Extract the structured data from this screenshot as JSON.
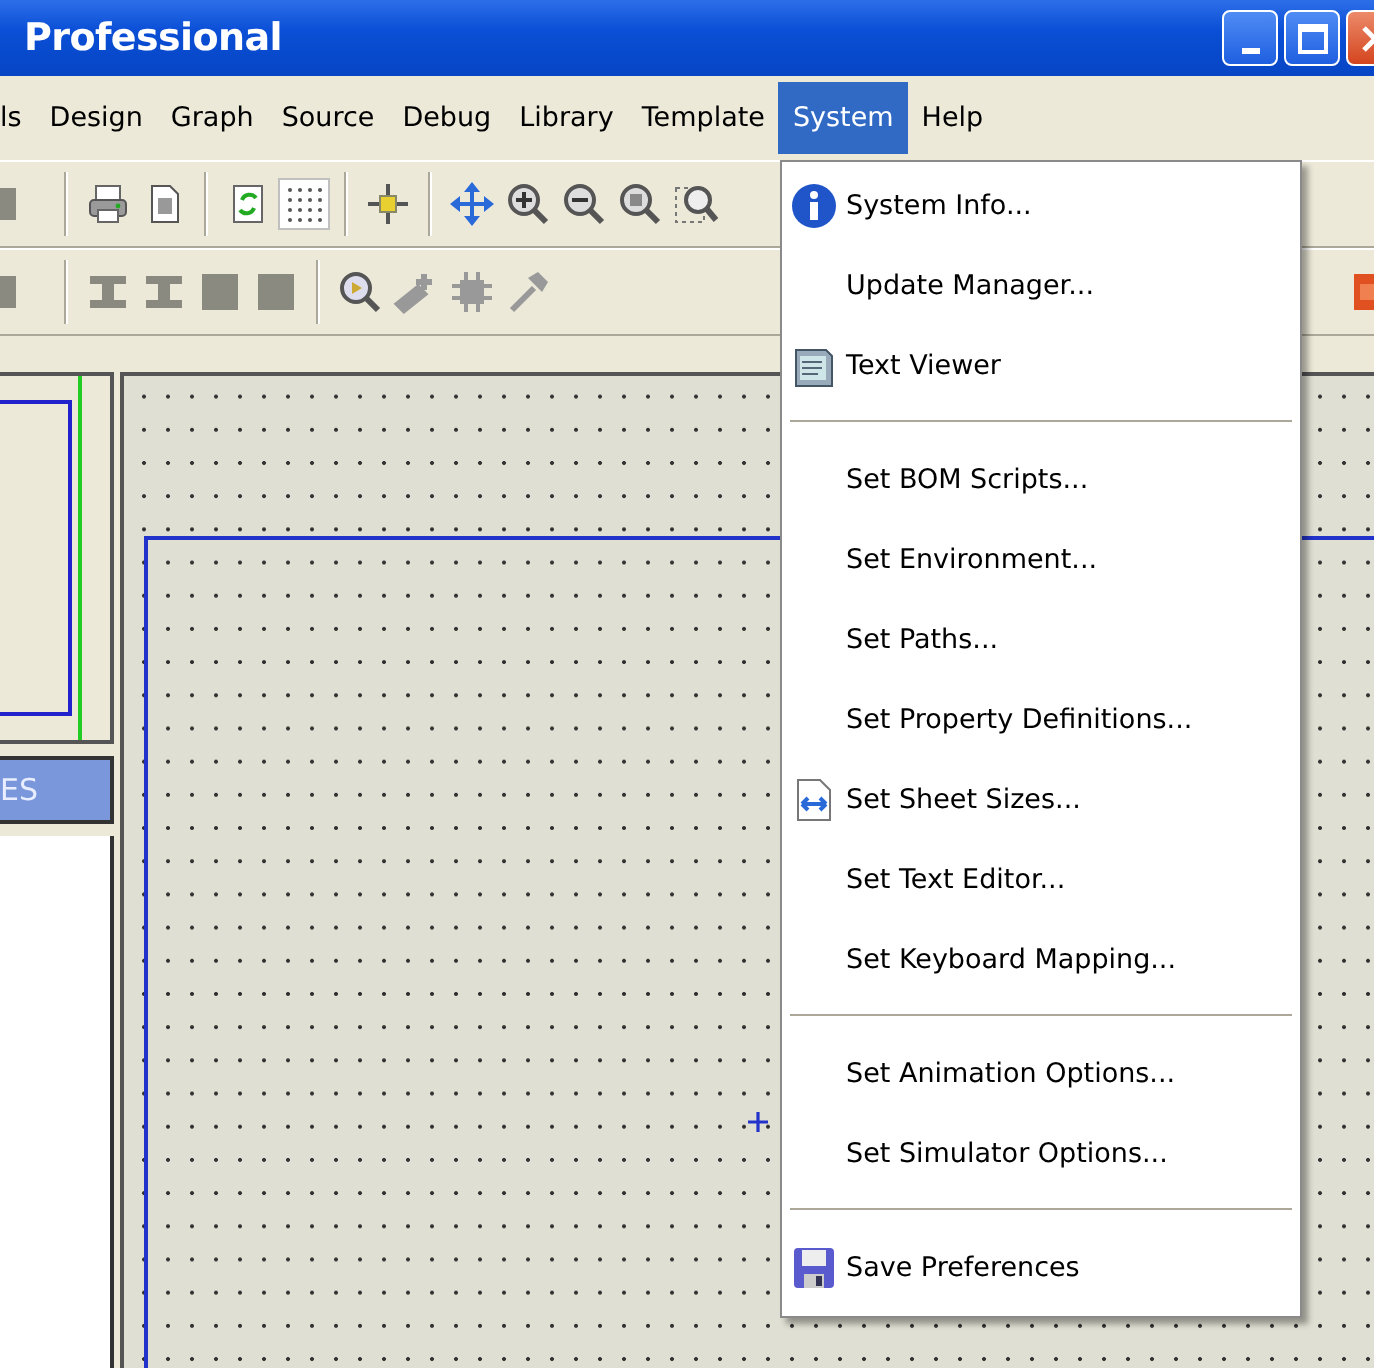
{
  "window": {
    "title": "Professional"
  },
  "menu_bar": [
    {
      "label": "ls",
      "selected": false
    },
    {
      "label": "Design",
      "selected": false
    },
    {
      "label": "Graph",
      "selected": false
    },
    {
      "label": "Source",
      "selected": false
    },
    {
      "label": "Debug",
      "selected": false
    },
    {
      "label": "Library",
      "selected": false
    },
    {
      "label": "Template",
      "selected": false
    },
    {
      "label": "System",
      "selected": true
    },
    {
      "label": "Help",
      "selected": false
    }
  ],
  "left_panel": {
    "header": "ES"
  },
  "system_menu": {
    "items": [
      {
        "kind": "item",
        "label": "System Info..."
      },
      {
        "kind": "item",
        "label": "Update Manager..."
      },
      {
        "kind": "item",
        "label": "Text Viewer"
      },
      {
        "kind": "separator"
      },
      {
        "kind": "item",
        "label": "Set BOM Scripts..."
      },
      {
        "kind": "item",
        "label": "Set Environment..."
      },
      {
        "kind": "item",
        "label": "Set Paths..."
      },
      {
        "kind": "item",
        "label": "Set Property Definitions..."
      },
      {
        "kind": "item",
        "label": "Set Sheet Sizes..."
      },
      {
        "kind": "item",
        "label": "Set Text Editor..."
      },
      {
        "kind": "item",
        "label": "Set Keyboard Mapping..."
      },
      {
        "kind": "separator"
      },
      {
        "kind": "item",
        "label": "Set Animation Options..."
      },
      {
        "kind": "item",
        "label": "Set Simulator Options..."
      },
      {
        "kind": "separator"
      },
      {
        "kind": "item",
        "label": "Save Preferences"
      }
    ]
  }
}
